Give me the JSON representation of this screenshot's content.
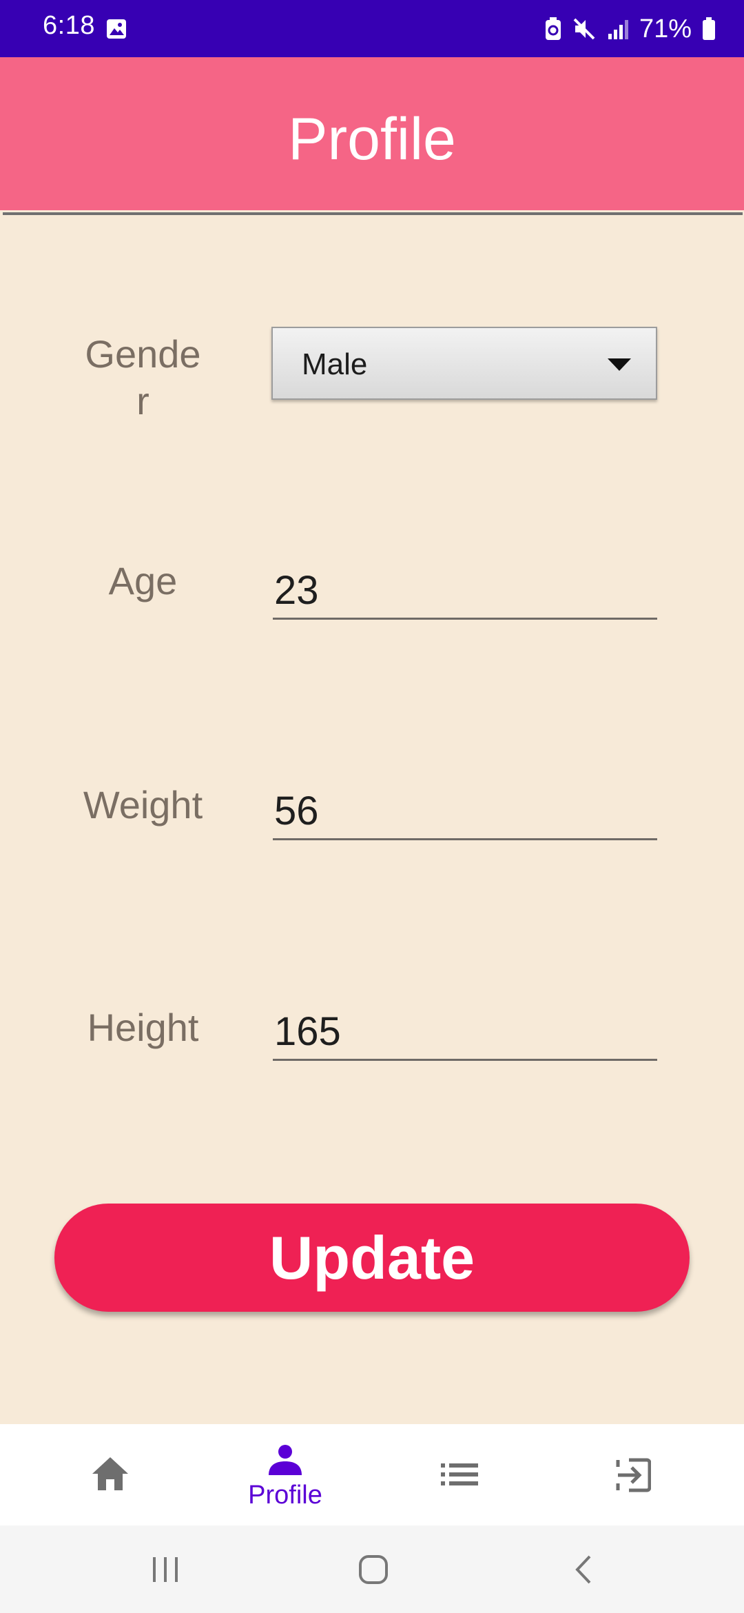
{
  "status_bar": {
    "time": "6:18",
    "battery_percent": "71%",
    "icons": [
      "gallery-icon",
      "battery-saver-icon",
      "mute-icon",
      "signal-icon",
      "battery-icon"
    ]
  },
  "app_bar": {
    "title": "Profile"
  },
  "form": {
    "gender": {
      "label": "Gende\nr",
      "selected": "Male"
    },
    "age": {
      "label": "Age",
      "value": "23"
    },
    "weight": {
      "label": "Weight",
      "value": "56"
    },
    "height": {
      "label": "Height",
      "value": "165"
    }
  },
  "update_button": {
    "label": "Update"
  },
  "bottom_nav": {
    "items": [
      {
        "icon": "home-icon",
        "label": ""
      },
      {
        "icon": "person-icon",
        "label": "Profile",
        "active": true
      },
      {
        "icon": "list-icon",
        "label": ""
      },
      {
        "icon": "exit-icon",
        "label": ""
      }
    ]
  },
  "colors": {
    "status_bar": "#3700B3",
    "app_bar": "#F56586",
    "background": "#F7EAD8",
    "button": "#EF2154",
    "nav_active": "#5B00D6",
    "nav_inactive": "#6E6E6E"
  }
}
